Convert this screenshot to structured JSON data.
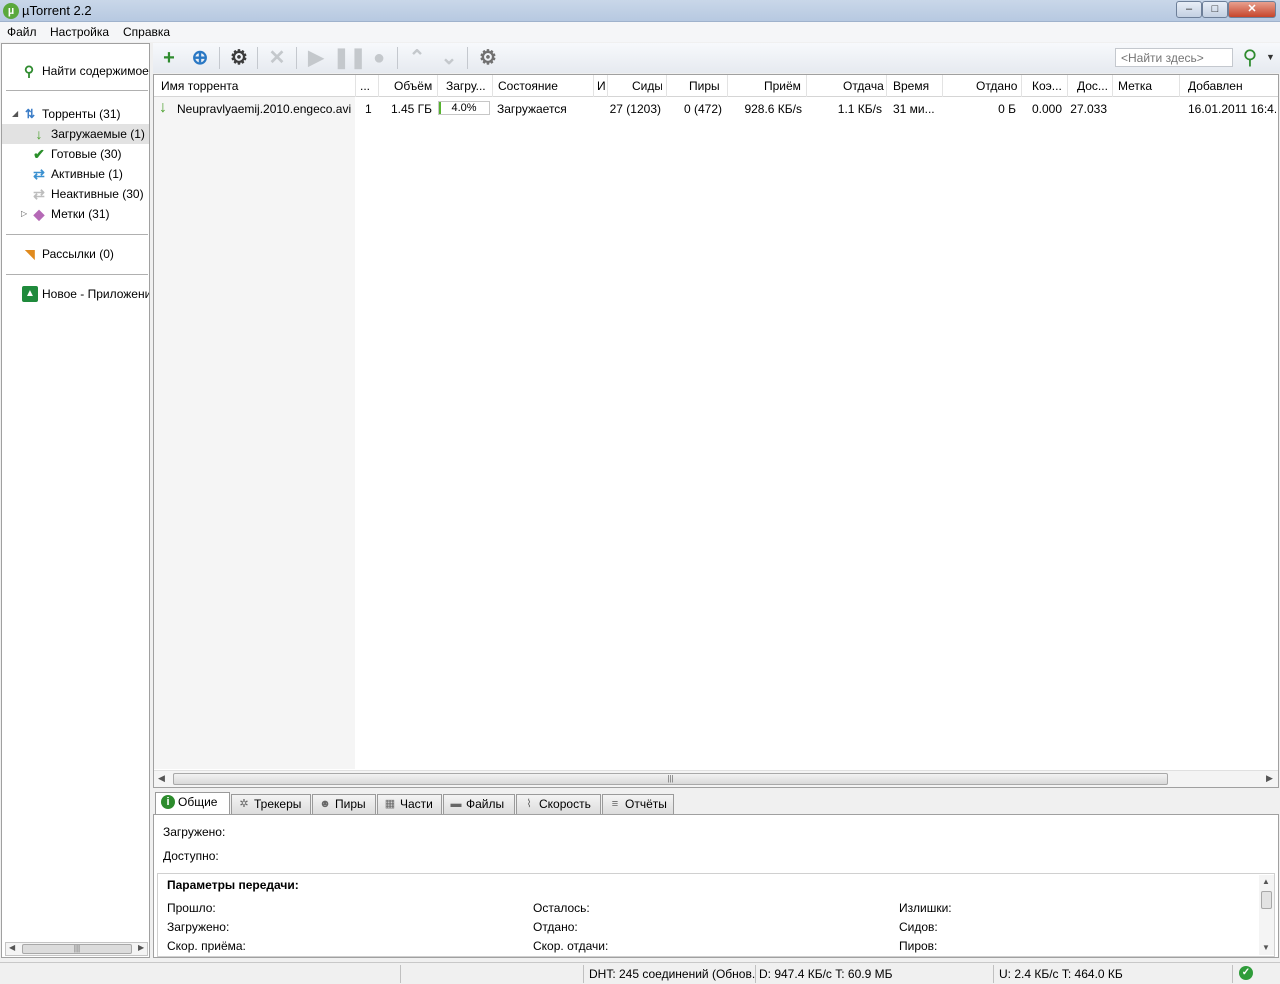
{
  "window": {
    "title": "µTorrent 2.2",
    "min": "–",
    "max": "□",
    "close": "✕"
  },
  "menu": [
    "Файл",
    "Настройка",
    "Справка"
  ],
  "sidebar": {
    "find_content": "Найти содержимое",
    "torrents": "Торренты (31)",
    "downloading": "Загружаемые (1)",
    "completed": "Готовые (30)",
    "active": "Активные (1)",
    "inactive": "Неактивные (30)",
    "labels": "Метки (31)",
    "feeds": "Рассылки (0)",
    "apps": "Новое - Приложения"
  },
  "toolbar": {
    "search_placeholder": "<Найти здесь>"
  },
  "columns": [
    "Имя торрента",
    "...",
    "Объём",
    "Загру...",
    "Состояние",
    "И",
    "Сиды",
    "Пиры",
    "Приём",
    "Отдача",
    "Время",
    "Отдано",
    "Коэ...",
    "Дос...",
    "Метка",
    "Добавлен"
  ],
  "torrent": {
    "name": "Neupravlyaemij.2010.engeco.avi",
    "num": "1",
    "size": "1.45 ГБ",
    "progress": 4.0,
    "progress_text": "4.0%",
    "status": "Загружается",
    "seeds": "27 (1203)",
    "peers": "0 (472)",
    "down": "928.6 КБ/s",
    "up": "1.1 КБ/s",
    "eta": "31 ми...",
    "uploaded": "0 Б",
    "ratio": "0.000",
    "avail": "27.033",
    "label": "",
    "added": "16.01.2011 16:4..."
  },
  "tabs": [
    "Общие",
    "Трекеры",
    "Пиры",
    "Части",
    "Файлы",
    "Скорость",
    "Отчёты"
  ],
  "detail": {
    "downloaded_label": "Загружено:",
    "available_label": "Доступно:",
    "params_title": "Параметры передачи:",
    "elapsed": "Прошло:",
    "remaining": "Осталось:",
    "wasted": "Излишки:",
    "downloaded": "Загружено:",
    "uploaded": "Отдано:",
    "seeds": "Сидов:",
    "down_speed": "Скор. приёма:",
    "up_speed": "Скор. отдачи:",
    "peers": "Пиров:"
  },
  "status": {
    "dht": "DHT: 245 соединений  (Обнов.",
    "down": "D: 947.4 КБ/с T: 60.9 МБ",
    "up": "U: 2.4 КБ/с T: 464.0 КБ"
  },
  "colors": {
    "accent_green": "#2f9c3a",
    "progress_green": "#56b32f"
  }
}
